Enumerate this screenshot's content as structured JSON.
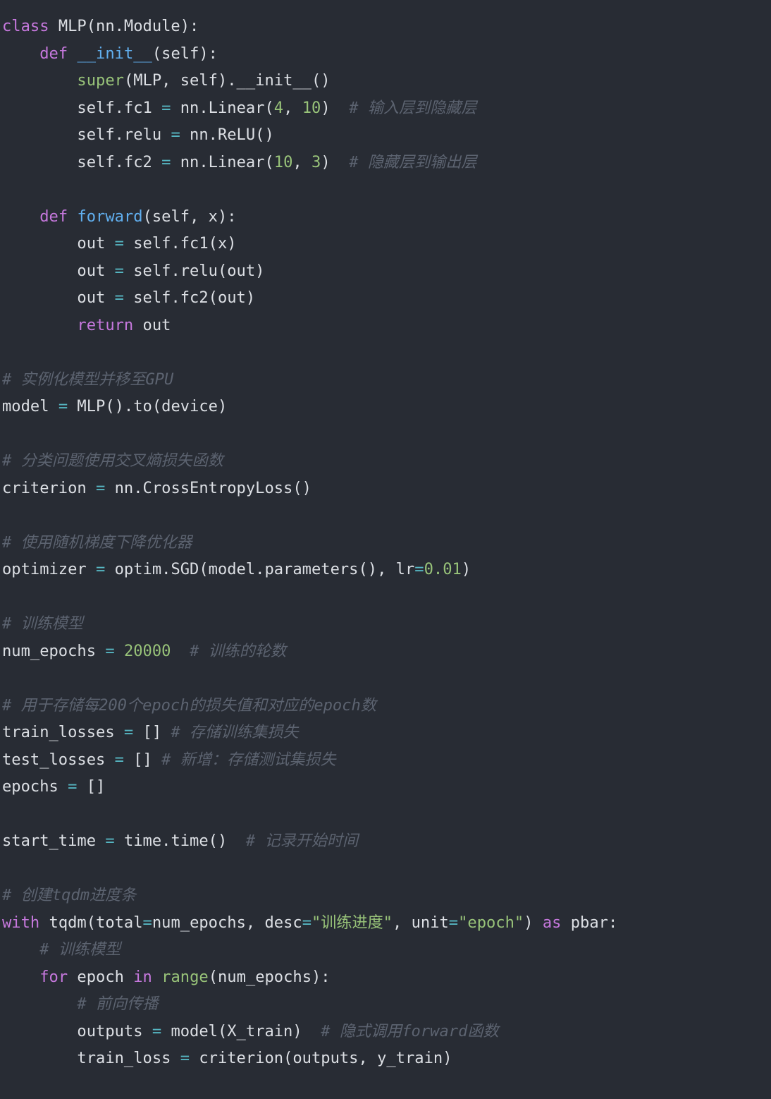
{
  "colors": {
    "background": "#282c34",
    "text": "#dcdfe4",
    "keyword": "#c678dd",
    "builtin": "#98c379",
    "function": "#61afef",
    "number": "#98c379",
    "string": "#98c379",
    "operator": "#56b6c2",
    "comment": "#5c6370"
  },
  "code_lines": [
    [
      [
        "kw",
        "class"
      ],
      [
        "tx",
        " MLP(nn.Module):"
      ]
    ],
    [
      [
        "tx",
        "    "
      ],
      [
        "kw",
        "def"
      ],
      [
        "tx",
        " "
      ],
      [
        "fn",
        "__init__"
      ],
      [
        "tx",
        "(self):"
      ]
    ],
    [
      [
        "tx",
        "        "
      ],
      [
        "bi",
        "super"
      ],
      [
        "tx",
        "(MLP, self).__init__()"
      ]
    ],
    [
      [
        "tx",
        "        self.fc1 "
      ],
      [
        "op",
        "="
      ],
      [
        "tx",
        " nn.Linear("
      ],
      [
        "num",
        "4"
      ],
      [
        "tx",
        ", "
      ],
      [
        "num",
        "10"
      ],
      [
        "tx",
        ")  "
      ],
      [
        "cm",
        "# 输入层到隐藏层"
      ]
    ],
    [
      [
        "tx",
        "        self.relu "
      ],
      [
        "op",
        "="
      ],
      [
        "tx",
        " nn.ReLU()"
      ]
    ],
    [
      [
        "tx",
        "        self.fc2 "
      ],
      [
        "op",
        "="
      ],
      [
        "tx",
        " nn.Linear("
      ],
      [
        "num",
        "10"
      ],
      [
        "tx",
        ", "
      ],
      [
        "num",
        "3"
      ],
      [
        "tx",
        ")  "
      ],
      [
        "cm",
        "# 隐藏层到输出层"
      ]
    ],
    [],
    [
      [
        "tx",
        "    "
      ],
      [
        "kw",
        "def"
      ],
      [
        "tx",
        " "
      ],
      [
        "fn",
        "forward"
      ],
      [
        "tx",
        "(self, x):"
      ]
    ],
    [
      [
        "tx",
        "        out "
      ],
      [
        "op",
        "="
      ],
      [
        "tx",
        " self.fc1(x)"
      ]
    ],
    [
      [
        "tx",
        "        out "
      ],
      [
        "op",
        "="
      ],
      [
        "tx",
        " self.relu(out)"
      ]
    ],
    [
      [
        "tx",
        "        out "
      ],
      [
        "op",
        "="
      ],
      [
        "tx",
        " self.fc2(out)"
      ]
    ],
    [
      [
        "tx",
        "        "
      ],
      [
        "kw",
        "return"
      ],
      [
        "tx",
        " out"
      ]
    ],
    [],
    [
      [
        "cm",
        "# 实例化模型并移至GPU"
      ]
    ],
    [
      [
        "tx",
        "model "
      ],
      [
        "op",
        "="
      ],
      [
        "tx",
        " MLP().to(device)"
      ]
    ],
    [],
    [
      [
        "cm",
        "# 分类问题使用交叉熵损失函数"
      ]
    ],
    [
      [
        "tx",
        "criterion "
      ],
      [
        "op",
        "="
      ],
      [
        "tx",
        " nn.CrossEntropyLoss()"
      ]
    ],
    [],
    [
      [
        "cm",
        "# 使用随机梯度下降优化器"
      ]
    ],
    [
      [
        "tx",
        "optimizer "
      ],
      [
        "op",
        "="
      ],
      [
        "tx",
        " optim.SGD(model.parameters(), lr"
      ],
      [
        "op",
        "="
      ],
      [
        "num",
        "0.01"
      ],
      [
        "tx",
        ")"
      ]
    ],
    [],
    [
      [
        "cm",
        "# 训练模型"
      ]
    ],
    [
      [
        "tx",
        "num_epochs "
      ],
      [
        "op",
        "="
      ],
      [
        "tx",
        " "
      ],
      [
        "num",
        "20000"
      ],
      [
        "tx",
        "  "
      ],
      [
        "cm",
        "# 训练的轮数"
      ]
    ],
    [],
    [
      [
        "cm",
        "# 用于存储每200个epoch的损失值和对应的epoch数"
      ]
    ],
    [
      [
        "tx",
        "train_losses "
      ],
      [
        "op",
        "="
      ],
      [
        "tx",
        " [] "
      ],
      [
        "cm",
        "# 存储训练集损失"
      ]
    ],
    [
      [
        "tx",
        "test_losses "
      ],
      [
        "op",
        "="
      ],
      [
        "tx",
        " [] "
      ],
      [
        "cm",
        "# 新增：存储测试集损失"
      ]
    ],
    [
      [
        "tx",
        "epochs "
      ],
      [
        "op",
        "="
      ],
      [
        "tx",
        " []"
      ]
    ],
    [],
    [
      [
        "tx",
        "start_time "
      ],
      [
        "op",
        "="
      ],
      [
        "tx",
        " time.time()  "
      ],
      [
        "cm",
        "# 记录开始时间"
      ]
    ],
    [],
    [
      [
        "cm",
        "# 创建tqdm进度条"
      ]
    ],
    [
      [
        "kw",
        "with"
      ],
      [
        "tx",
        " tqdm(total"
      ],
      [
        "op",
        "="
      ],
      [
        "tx",
        "num_epochs, desc"
      ],
      [
        "op",
        "="
      ],
      [
        "str",
        "\"训练进度\""
      ],
      [
        "tx",
        ", unit"
      ],
      [
        "op",
        "="
      ],
      [
        "str",
        "\"epoch\""
      ],
      [
        "tx",
        ") "
      ],
      [
        "kw",
        "as"
      ],
      [
        "tx",
        " pbar:"
      ]
    ],
    [
      [
        "tx",
        "    "
      ],
      [
        "cm",
        "# 训练模型"
      ]
    ],
    [
      [
        "tx",
        "    "
      ],
      [
        "kw",
        "for"
      ],
      [
        "tx",
        " epoch "
      ],
      [
        "kw",
        "in"
      ],
      [
        "tx",
        " "
      ],
      [
        "bi",
        "range"
      ],
      [
        "tx",
        "(num_epochs):"
      ]
    ],
    [
      [
        "tx",
        "        "
      ],
      [
        "cm",
        "# 前向传播"
      ]
    ],
    [
      [
        "tx",
        "        outputs "
      ],
      [
        "op",
        "="
      ],
      [
        "tx",
        " model(X_train)  "
      ],
      [
        "cm",
        "# 隐式调用forward函数"
      ]
    ],
    [
      [
        "tx",
        "        train_loss "
      ],
      [
        "op",
        "="
      ],
      [
        "tx",
        " criterion(outputs, y_train)"
      ]
    ]
  ]
}
